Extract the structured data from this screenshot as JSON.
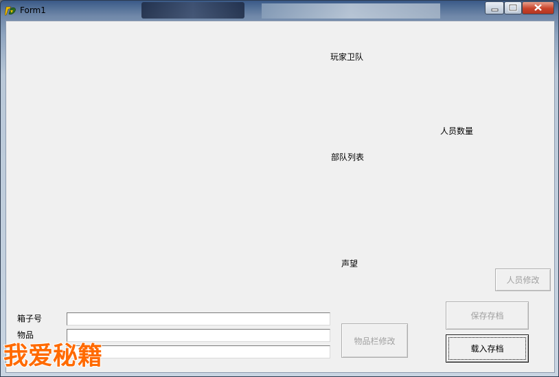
{
  "window": {
    "title": "Form1"
  },
  "labels": {
    "player_troops": "玩家卫队",
    "member_count": "人员数量",
    "troop_list": "部队列表",
    "reputation": "声望",
    "box_number": "箱子号",
    "item": "物品"
  },
  "fields": {
    "box_number_value": "",
    "item_value": "",
    "third_value": ""
  },
  "buttons": {
    "modify_member": "人员修改",
    "save_file": "保存存档",
    "modify_item_slot": "物品栏修改",
    "load_file": "载入存档"
  },
  "watermark": "我爱秘籍",
  "colors": {
    "client_bg": "#f0f0f0",
    "watermark": "#ff6a00",
    "close_button": "#c8432b"
  },
  "icons": {
    "app": "delphi-app-icon",
    "minimize": "minimize-icon",
    "maximize": "maximize-icon",
    "close": "close-icon"
  }
}
